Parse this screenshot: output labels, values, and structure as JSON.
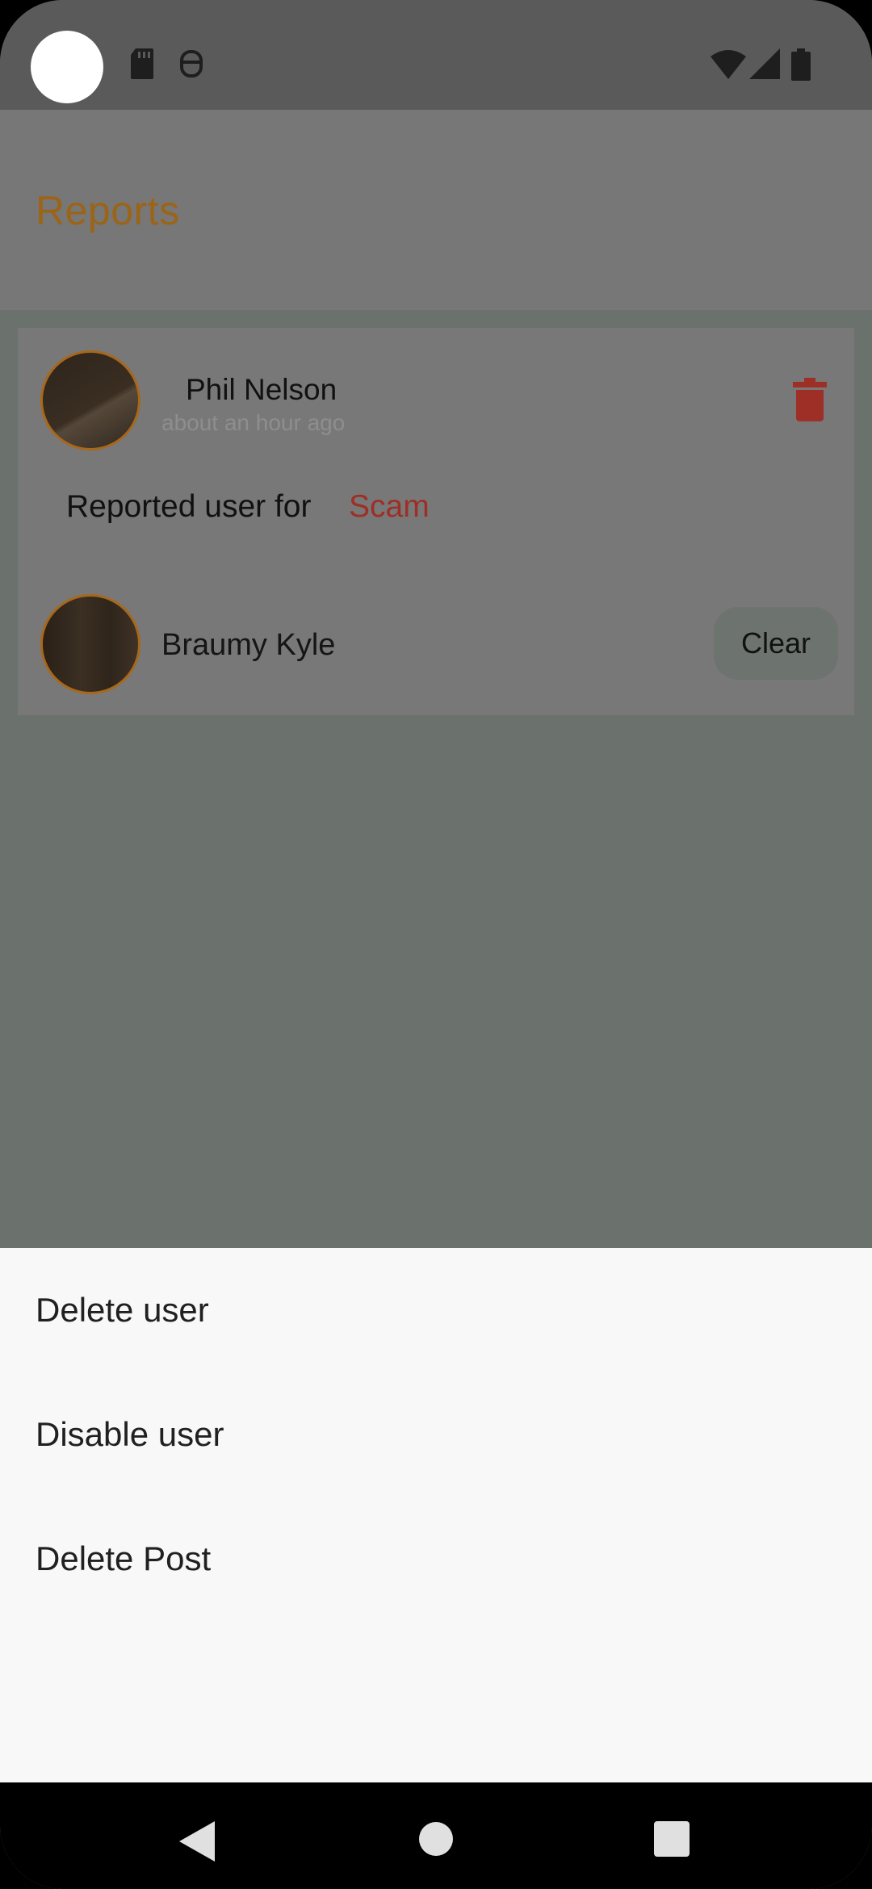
{
  "status_bar": {
    "icons": [
      "sd-card-icon",
      "face-icon",
      "wifi-icon",
      "signal-icon",
      "battery-icon"
    ]
  },
  "app_bar": {
    "title": "Reports"
  },
  "report": {
    "reporter": {
      "name": "Phil Nelson",
      "time": "about an hour ago"
    },
    "reported_label": "Reported user for",
    "reason": "Scam",
    "reported_user": {
      "name": "Braumy Kyle"
    },
    "clear_label": "Clear"
  },
  "bottom_sheet": {
    "items": [
      {
        "label": "Delete user"
      },
      {
        "label": "Disable user"
      },
      {
        "label": "Delete Post"
      }
    ]
  },
  "colors": {
    "accent": "#9b6416",
    "reason": "#9d2f27",
    "delete": "#9d2f27"
  }
}
